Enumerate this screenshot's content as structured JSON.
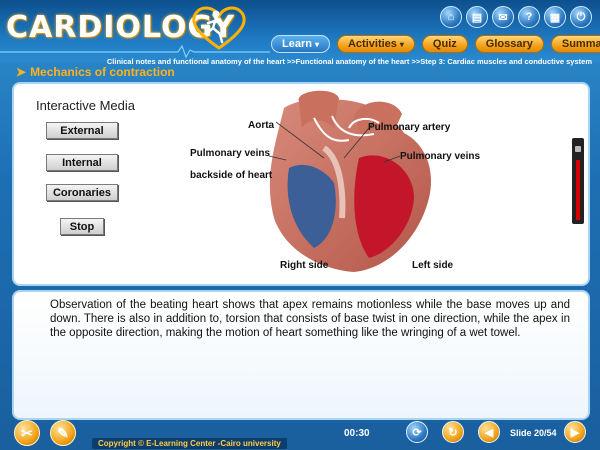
{
  "app": {
    "logo_text": "CARDIOLOGY"
  },
  "nav": {
    "learn": "Learn",
    "activities": "Activities",
    "quiz": "Quiz",
    "glossary": "Glossary",
    "summary": "Summary"
  },
  "top_icons": [
    "home-icon",
    "print-icon",
    "mail-icon",
    "help-icon",
    "notes-icon",
    "exit-icon"
  ],
  "breadcrumb": "Clinical notes and functional anatomy of the heart >>Functional anatomy of the heart >>Step 3: Cardiac muscles and conductive system",
  "section_title": "Mechanics of contraction",
  "interactive": {
    "title": "Interactive Media",
    "buttons": [
      "External",
      "Internal",
      "Coronaries",
      "Stop"
    ]
  },
  "diagram_labels": {
    "aorta": "Aorta",
    "pulmonary_artery": "Pulmonary artery",
    "pulmonary_veins_left": "Pulmonary veins",
    "pulmonary_veins_right": "Pulmonary veins",
    "backside": "backside of heart",
    "right_side": "Right side",
    "left_side": "Left side"
  },
  "body_text": "Observation of the beating heart shows that apex remains motionless while the base moves up and down. There is also in addition to, torsion that consists of base twist in one direction, while the apex in the opposite direction, making the motion of heart something like the wringing of a wet towel.",
  "footer": {
    "copyright": "Copyright © E-Learning Center -Cairo university",
    "timer": "00:30",
    "slide": "Slide 20/54"
  },
  "colors": {
    "accent": "#f4a21a",
    "background": "#1d6fb3",
    "heading": "#ffb21c"
  }
}
